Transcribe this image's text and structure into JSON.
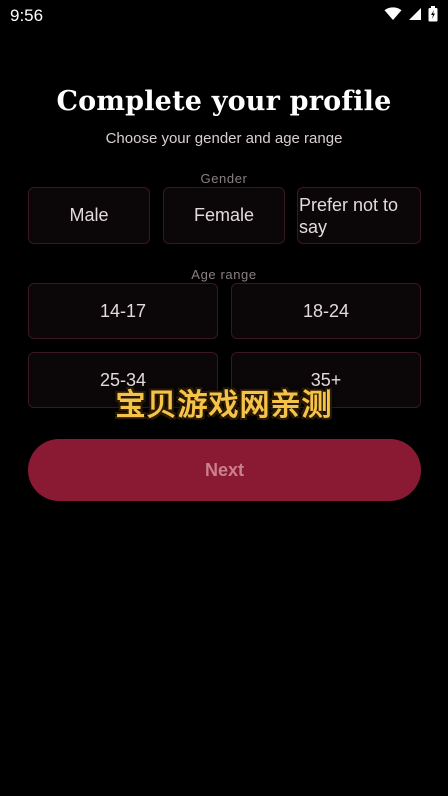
{
  "status_bar": {
    "time": "9:56",
    "icons": [
      "wifi-icon",
      "signal-icon",
      "battery-icon"
    ]
  },
  "header": {
    "title": "Complete your profile",
    "subtitle": "Choose your gender and age range"
  },
  "gender": {
    "label": "Gender",
    "options": [
      "Male",
      "Female",
      "Prefer not to say"
    ]
  },
  "age": {
    "label": "Age range",
    "options": [
      "14-17",
      "18-24",
      "25-34",
      "35+"
    ]
  },
  "next_button": {
    "label": "Next"
  },
  "watermark": {
    "text": "宝贝游戏网亲测"
  },
  "colors": {
    "background": "#000000",
    "card_border": "#3a1820",
    "accent_button": "#8a1a33",
    "button_text": "#c9808f",
    "watermark": "#f5c24a"
  }
}
